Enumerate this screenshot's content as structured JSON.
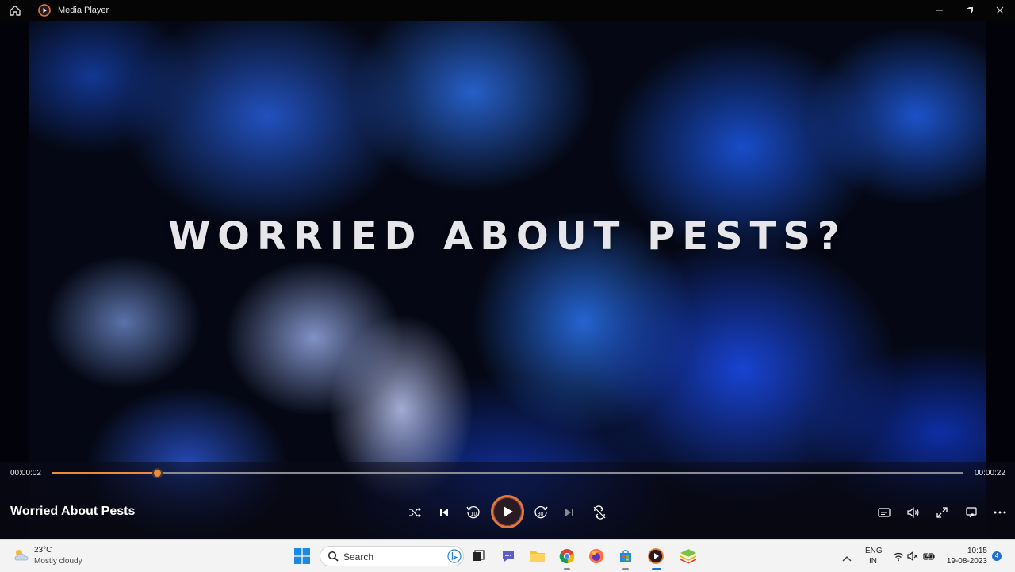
{
  "window": {
    "title": "Media Player"
  },
  "video": {
    "headline": "WORRIED ABOUT PESTS?"
  },
  "player": {
    "current_time": "00:00:02",
    "total_time": "00:00:22",
    "progress": 0.116,
    "track_title": "Worried About Pests",
    "skip_back_seconds": "10",
    "skip_forward_seconds": "30"
  },
  "taskbar": {
    "weather": {
      "temperature": "23°C",
      "description": "Mostly cloudy"
    },
    "search_placeholder": "Search",
    "language_top": "ENG",
    "language_bottom": "IN",
    "time": "10:15",
    "date": "19-08-2023",
    "notification_count": "4"
  },
  "colors": {
    "accent": "#f0893a",
    "taskbar_bg": "#f3f3f3"
  }
}
